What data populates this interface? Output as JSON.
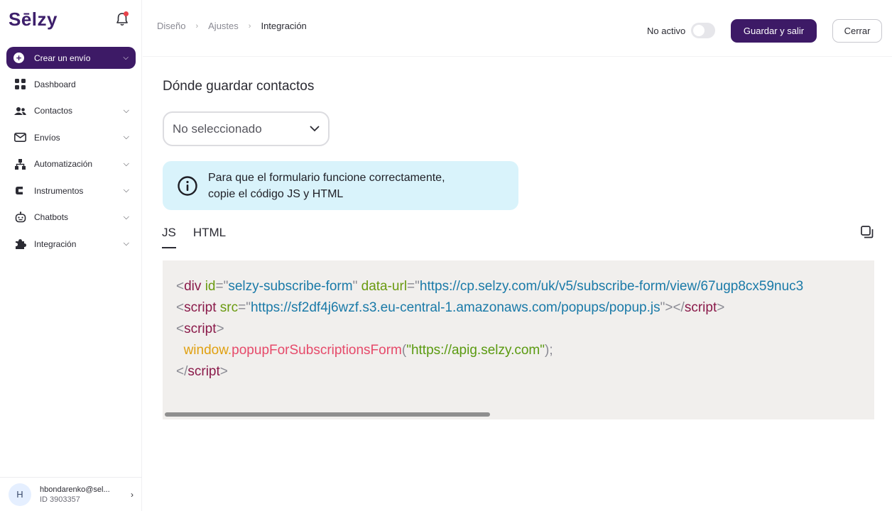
{
  "sidebar": {
    "logo": "Sēlzy",
    "create_button": "Crear un envío",
    "items": [
      {
        "label": "Dashboard",
        "icon": "dashboard-icon",
        "has_chevron": false
      },
      {
        "label": "Contactos",
        "icon": "contacts-icon",
        "has_chevron": true
      },
      {
        "label": "Envíos",
        "icon": "mail-icon",
        "has_chevron": true
      },
      {
        "label": "Automatización",
        "icon": "automation-icon",
        "has_chevron": true
      },
      {
        "label": "Instrumentos",
        "icon": "tools-icon",
        "has_chevron": true
      },
      {
        "label": "Chatbots",
        "icon": "chatbot-icon",
        "has_chevron": true
      },
      {
        "label": "Integración",
        "icon": "puzzle-icon",
        "has_chevron": true
      }
    ],
    "user": {
      "initial": "H",
      "email": "hbondarenko@sel...",
      "id": "ID 3903357"
    }
  },
  "header": {
    "breadcrumb": [
      "Diseño",
      "Ajustes",
      "Integración"
    ],
    "status_label": "No activo",
    "save_button": "Guardar y salir",
    "close_button": "Cerrar"
  },
  "main": {
    "section_title": "Dónde guardar contactos",
    "select_value": "No seleccionado",
    "info_line1": "Para que el formulario funcione correctamente,",
    "info_line2": "copie el código JS y HTML",
    "tabs": [
      {
        "label": "JS",
        "active": true
      },
      {
        "label": "HTML",
        "active": false
      }
    ],
    "code": {
      "line1": {
        "tag": "div",
        "attr1": "id",
        "val1": "selzy-subscribe-form",
        "attr2": "data-url",
        "val2": "https://cp.selzy.com/uk/v5/subscribe-form/view/67ugp8cx59nuc3"
      },
      "line2": {
        "tag": "script",
        "attr": "src",
        "val": "https://sf2df4j6wzf.s3.eu-central-1.amazonaws.com/popups/popup.js",
        "close_tag": "script"
      },
      "line3": {
        "tag": "script"
      },
      "line4": {
        "obj": "window.",
        "fn": "popupForSubscriptionsForm",
        "arg": "\"https://apig.selzy.com\""
      },
      "line5": {
        "tag": "script"
      }
    }
  },
  "colors": {
    "brand": "#3d1a66",
    "info_bg": "#d9f3fb",
    "code_bg": "#f1efed"
  }
}
